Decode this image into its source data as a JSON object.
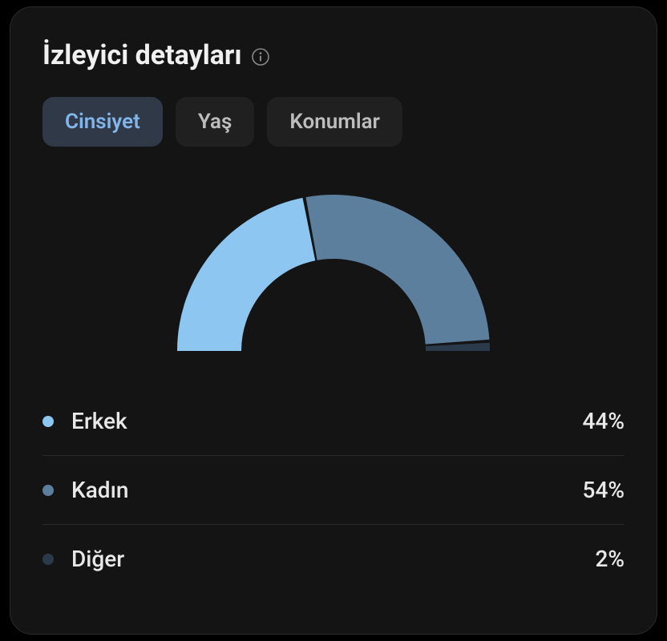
{
  "title": "İzleyici detayları",
  "tabs": [
    {
      "label": "Cinsiyet",
      "active": true
    },
    {
      "label": "Yaş",
      "active": false
    },
    {
      "label": "Konumlar",
      "active": false
    }
  ],
  "chart_data": {
    "type": "pie",
    "title": "İzleyici detayları",
    "series": [
      {
        "name": "Erkek",
        "value": 44,
        "color": "#8dc6f0",
        "display": "44%"
      },
      {
        "name": "Kadın",
        "value": 54,
        "color": "#5d7f9e",
        "display": "54%"
      },
      {
        "name": "Diğer",
        "value": 2,
        "color": "#2b3a4a",
        "display": "2%"
      }
    ]
  }
}
